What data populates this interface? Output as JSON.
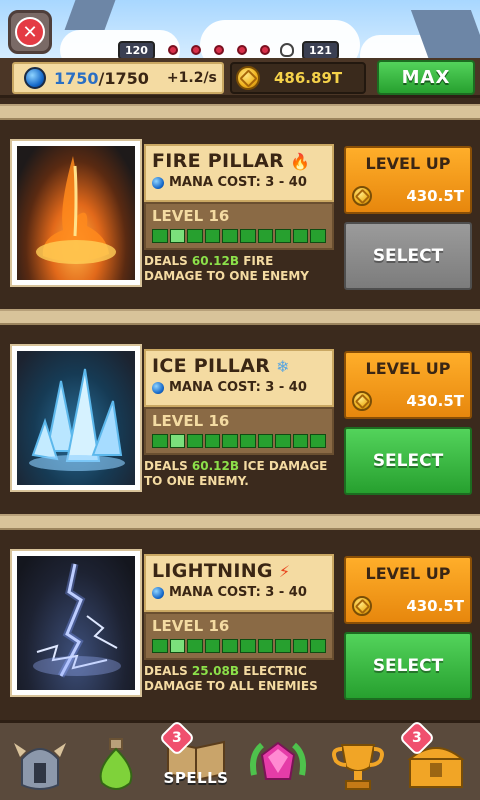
{
  "top": {
    "wave_left": "120",
    "wave_right": "121"
  },
  "resources": {
    "mana_current": "1750",
    "mana_max": "/1750",
    "mana_rate": "+1.2/s",
    "gold": "486.89T",
    "max_label": "MAX"
  },
  "spells": [
    {
      "name": "FIRE PILLAR",
      "icon": "fire-icon",
      "mana_cost": "MANA COST: 3 - 40",
      "level": "LEVEL 16",
      "desc_pre": "DEALS ",
      "desc_val": "60.12B",
      "desc_post": " FIRE DAMAGE TO ONE ENEMY",
      "level_up_label": "LEVEL UP",
      "level_up_cost": "430.5T",
      "select_label": "SELECT",
      "select_state": "selected"
    },
    {
      "name": "ICE PILLAR",
      "icon": "snowflake-icon",
      "mana_cost": "MANA COST: 3 - 40",
      "level": "LEVEL 16",
      "desc_pre": "DEALS ",
      "desc_val": "60.12B",
      "desc_post": " ICE DAMAGE TO ONE ENEMY.",
      "level_up_label": "LEVEL UP",
      "level_up_cost": "430.5T",
      "select_label": "SELECT",
      "select_state": "available"
    },
    {
      "name": "LIGHTNING",
      "icon": "lightning-icon",
      "mana_cost": "MANA COST: 3 - 40",
      "level": "LEVEL 16",
      "desc_pre": "DEALS ",
      "desc_val": "25.08B",
      "desc_post": " ELECTRIC DAMAGE TO ALL ENEMIES",
      "level_up_label": "LEVEL UP",
      "level_up_cost": "430.5T",
      "select_label": "SELECT",
      "select_state": "available"
    }
  ],
  "nav": {
    "spells_label": "SPELLS",
    "spells_badge": "3",
    "chest_badge": "3"
  },
  "colors": {
    "accent_green": "#27a02f",
    "accent_orange": "#e7870d",
    "parchment": "#f4dba2",
    "panel_brown": "#3b2a1d"
  }
}
